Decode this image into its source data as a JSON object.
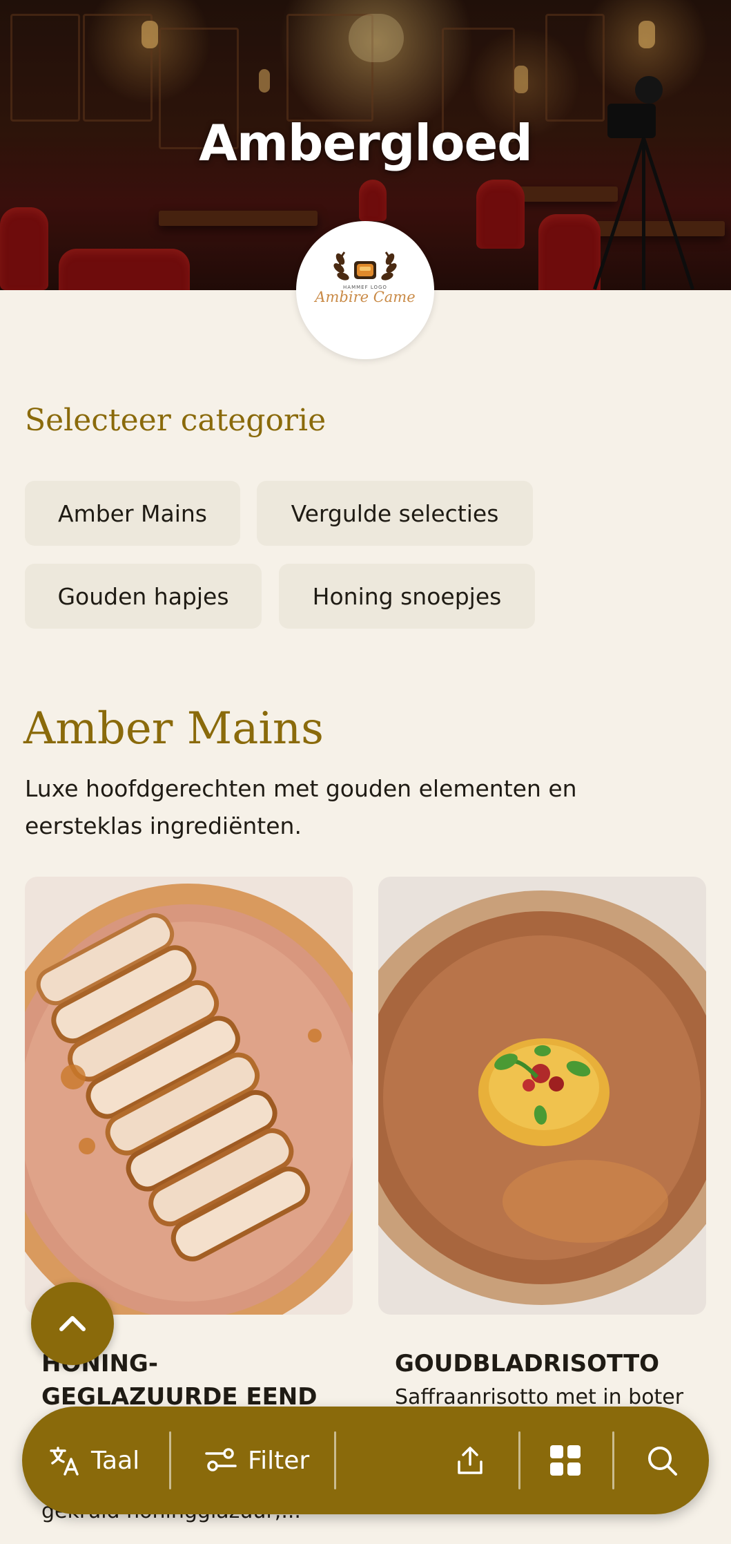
{
  "restaurant": {
    "name": "Ambergloed",
    "logo": {
      "sub_text": "HAMMEF LOGO",
      "script_text": "Ambire Came",
      "icon": "wreath-sun-logo-icon"
    }
  },
  "category_selector": {
    "label": "Selecteer categorie",
    "chips": [
      "Amber Mains",
      "Vergulde selecties",
      "Gouden hapjes",
      "Honing snoepjes"
    ]
  },
  "current_category": {
    "title": "Amber Mains",
    "description": "Luxe hoofdgerechten met gouden elementen en eersteklas ingrediënten.",
    "items": [
      {
        "name_line1": "HONING-",
        "name_line2": "GEGLAZUURDE EEND",
        "description_fragment": "gekruid honingglazuur,..."
      },
      {
        "name": "GOUDBLADRISOTTO",
        "description": "Saffraanrisotto met in boter"
      }
    ]
  },
  "bottom_bar": {
    "language": {
      "label": "Taal",
      "icon": "translate-icon"
    },
    "filter": {
      "label": "Filter",
      "icon": "sliders-icon"
    },
    "share": {
      "icon": "share-upload-icon"
    },
    "grid": {
      "icon": "grid-icon"
    },
    "search": {
      "icon": "search-icon"
    }
  },
  "scroll_top": {
    "icon": "chevron-up-icon"
  },
  "colors": {
    "accent": "#8a6a0b",
    "background": "#f6f1e8",
    "chip": "#ede8dc",
    "text": "#1f1b14"
  }
}
